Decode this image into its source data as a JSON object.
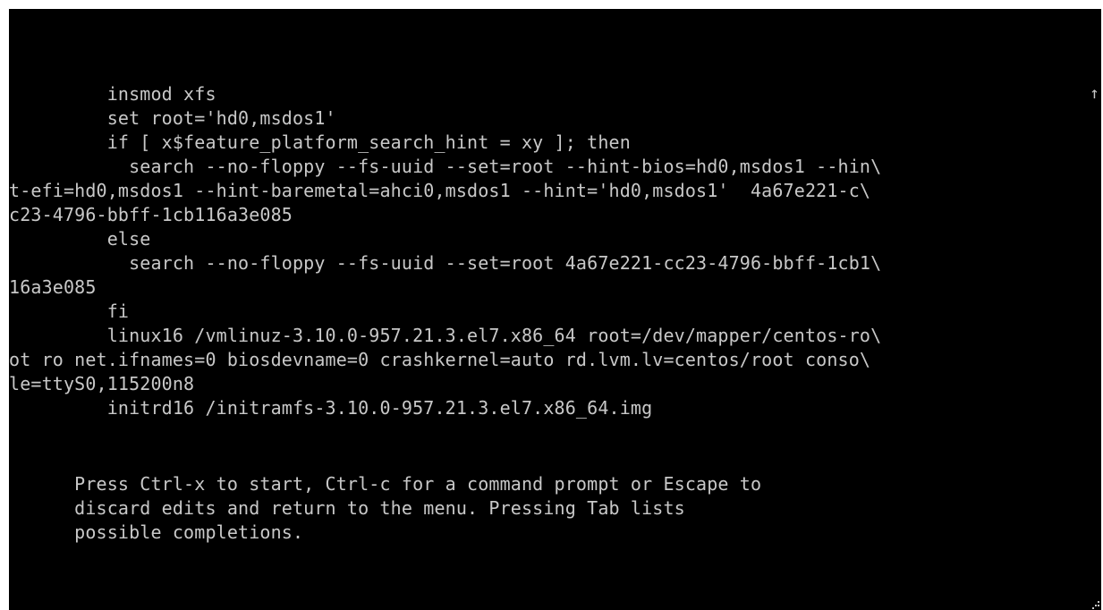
{
  "editor": {
    "lines": [
      "         insmod xfs",
      "         set root='hd0,msdos1'",
      "         if [ x$feature_platform_search_hint = xy ]; then",
      "           search --no-floppy --fs-uuid --set=root --hint-bios=hd0,msdos1 --hin\\",
      "t-efi=hd0,msdos1 --hint-baremetal=ahci0,msdos1 --hint='hd0,msdos1'  4a67e221-c\\",
      "c23-4796-bbff-1cb116a3e085",
      "         else",
      "           search --no-floppy --fs-uuid --set=root 4a67e221-cc23-4796-bbff-1cb1\\",
      "16a3e085",
      "         fi",
      "         linux16 /vmlinuz-3.10.0-957.21.3.el7.x86_64 root=/dev/mapper/centos-ro\\",
      "ot ro net.ifnames=0 biosdevname=0 crashkernel=auto rd.lvm.lv=centos/root conso\\",
      "le=ttyS0,115200n8",
      "         initrd16 /initramfs-3.10.0-957.21.3.el7.x86_64.img"
    ],
    "scroll_indicator": "↑"
  },
  "help": {
    "line1": "      Press Ctrl-x to start, Ctrl-c for a command prompt or Escape to",
    "line2": "      discard edits and return to the menu. Pressing Tab lists",
    "line3": "      possible completions."
  },
  "colors": {
    "background": "#000000",
    "text": "#c8c8c8",
    "frame": "#ffffff"
  }
}
